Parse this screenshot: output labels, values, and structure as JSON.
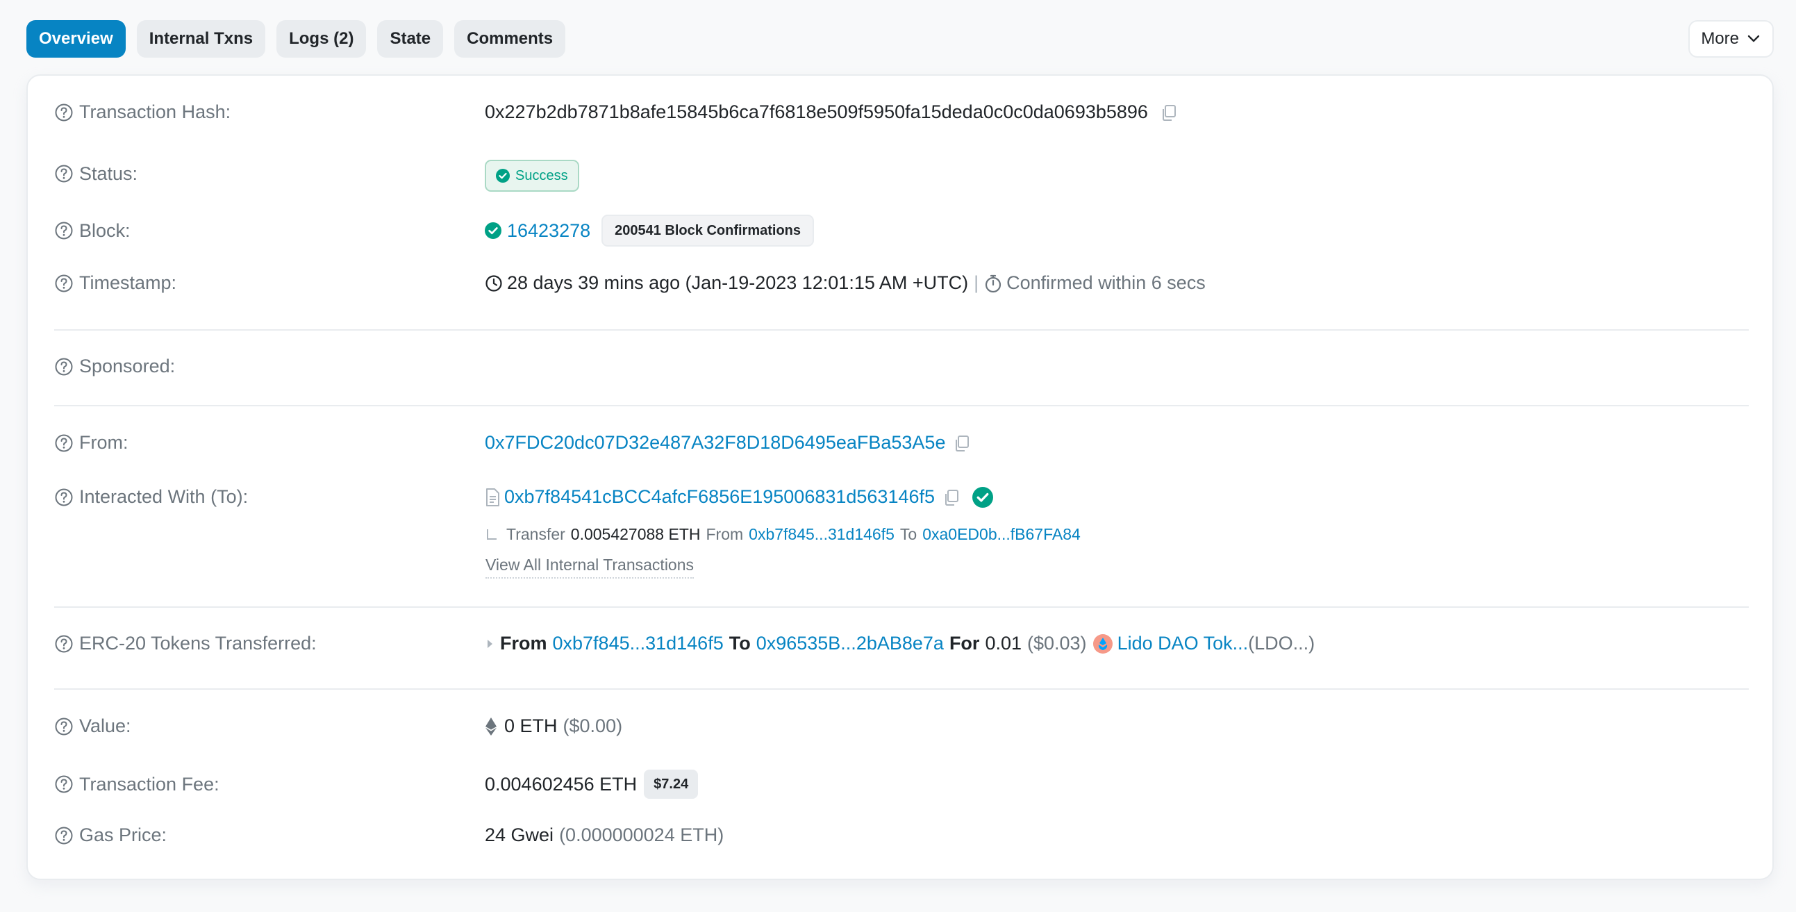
{
  "tabs": [
    {
      "label": "Overview",
      "active": true
    },
    {
      "label": "Internal Txns",
      "active": false
    },
    {
      "label": "Logs (2)",
      "active": false
    },
    {
      "label": "State",
      "active": false
    },
    {
      "label": "Comments",
      "active": false
    }
  ],
  "more_label": "More",
  "labels": {
    "tx_hash": "Transaction Hash:",
    "status": "Status:",
    "block": "Block:",
    "timestamp": "Timestamp:",
    "sponsored": "Sponsored:",
    "from": "From:",
    "to": "Interacted With (To):",
    "erc20": "ERC-20 Tokens Transferred:",
    "value": "Value:",
    "fee": "Transaction Fee:",
    "gas": "Gas Price:"
  },
  "tx_hash": "0x227b2db7871b8afe15845b6ca7f6818e509f5950fa15deda0c0c0da0693b5896",
  "status": "Success",
  "block": {
    "number": "16423278",
    "confirmations": "200541 Block Confirmations"
  },
  "timestamp": {
    "text": "28 days 39 mins ago (Jan-19-2023 12:01:15 AM +UTC)",
    "separator": "|",
    "confirmed": "Confirmed within 6 secs"
  },
  "from_address": "0x7FDC20dc07D32e487A32F8D18D6495eaFBa53A5e",
  "to_address": "0xb7f84541cBCC4afcF6856E195006831d563146f5",
  "internal_transfer": {
    "prefix": "Transfer",
    "amount": "0.005427088 ETH",
    "from_word": "From",
    "from": "0xb7f845...31d146f5",
    "to_word": "To",
    "to": "0xa0ED0b...fB67FA84"
  },
  "view_all_internal": "View All Internal Transactions",
  "erc20": {
    "from_word": "From",
    "from": "0xb7f845...31d146f5",
    "to_word": "To",
    "to": "0x96535B...2bAB8e7a",
    "for_word": "For",
    "amount": "0.01",
    "usd": "($0.03)",
    "token": "Lido DAO Tok...",
    "symbol": "(LDO...)"
  },
  "value": {
    "eth": "0 ETH",
    "usd": "($0.00)"
  },
  "fee": {
    "eth": "0.004602456 ETH",
    "usd": "$7.24"
  },
  "gas": {
    "gwei": "24 Gwei",
    "eth": "(0.000000024 ETH)"
  },
  "colors": {
    "accent": "#0784c3",
    "success": "#00a186",
    "muted": "#6c757d"
  }
}
